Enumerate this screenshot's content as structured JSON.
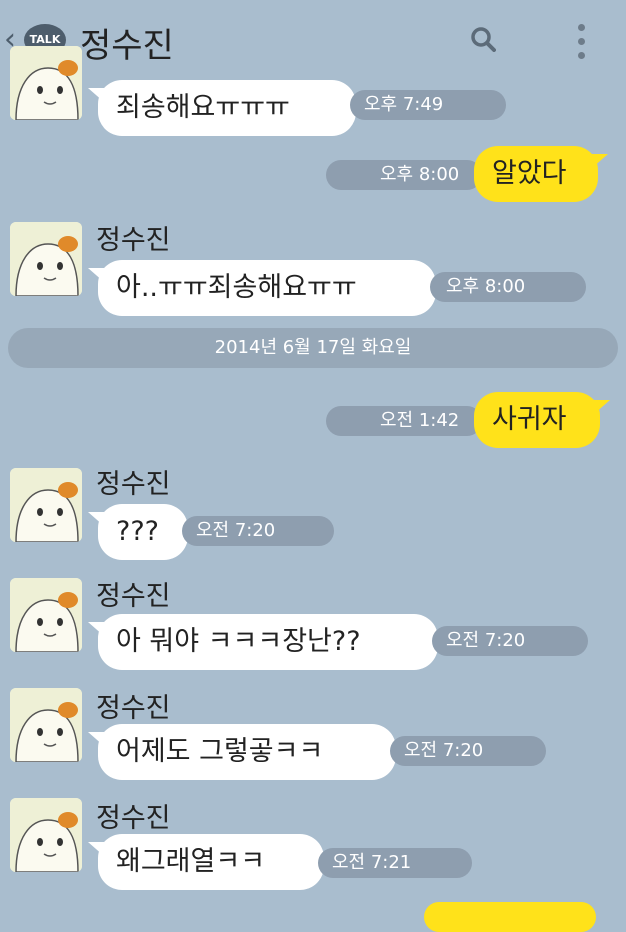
{
  "header": {
    "back_glyph": "‹",
    "talk_badge": "TALK",
    "title": "정수진",
    "search_icon": "search-icon",
    "more_icon": "more-vertical-icon"
  },
  "colors": {
    "background": "#a9bdce",
    "incoming_bubble": "#ffffff",
    "outgoing_bubble": "#ffe21a",
    "time_pill": "#8e9eaf"
  },
  "date_separator": "2014년 6월 17일 화요일",
  "messages": [
    {
      "from": "contact",
      "show_name": false,
      "sender": "",
      "text": "죄송해요ㅠㅠㅠ",
      "time": "오후 7:49"
    },
    {
      "from": "me",
      "text": "알았다",
      "time": "오후 8:00"
    },
    {
      "from": "contact",
      "show_name": true,
      "sender": "정수진",
      "text": "아..ㅠㅠ죄송해요ㅠㅠ",
      "time": "오후 8:00"
    },
    {
      "from": "me",
      "text": "사귀자",
      "time": "오전 1:42"
    },
    {
      "from": "contact",
      "show_name": true,
      "sender": "정수진",
      "text": "???",
      "time": "오전 7:20"
    },
    {
      "from": "contact",
      "show_name": true,
      "sender": "정수진",
      "text": "아 뭐야 ㅋㅋㅋ장난??",
      "time": "오전 7:20"
    },
    {
      "from": "contact",
      "show_name": true,
      "sender": "정수진",
      "text": "어제도 그렇곻ㅋㅋ",
      "time": "오전 7:20"
    },
    {
      "from": "contact",
      "show_name": true,
      "sender": "정수진",
      "text": "왜그래열ㅋㅋ",
      "time": "오전 7:21"
    }
  ]
}
